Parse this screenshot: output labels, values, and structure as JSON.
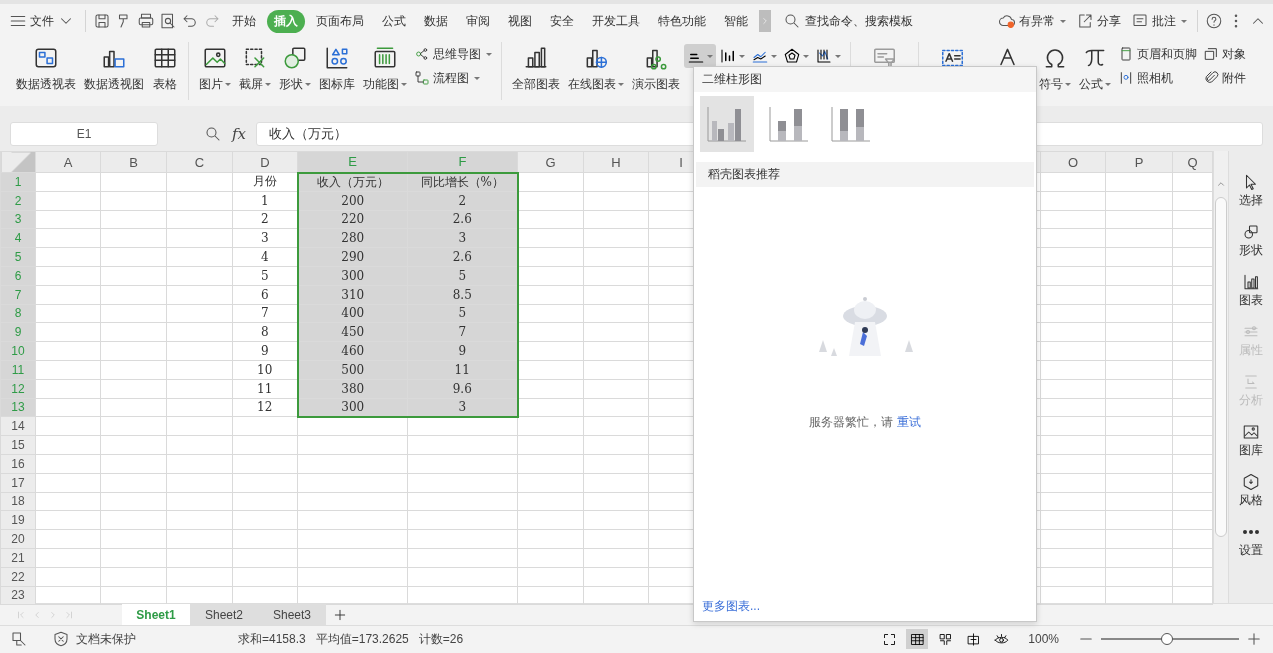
{
  "title_bar": {
    "menu": "文件",
    "tabs": [
      {
        "label": "开始",
        "selected": false
      },
      {
        "label": "插入",
        "selected": true
      },
      {
        "label": "页面布局",
        "selected": false
      },
      {
        "label": "公式",
        "selected": false
      },
      {
        "label": "数据",
        "selected": false
      },
      {
        "label": "审阅",
        "selected": false
      },
      {
        "label": "视图",
        "selected": false
      },
      {
        "label": "安全",
        "selected": false
      },
      {
        "label": "开发工具",
        "selected": false
      },
      {
        "label": "特色功能",
        "selected": false
      },
      {
        "label": "智能",
        "selected": false
      }
    ],
    "search": {
      "placeholder": "查找命令、搜索模板"
    },
    "actions": [
      {
        "label": "有异常",
        "dropdown": true
      },
      {
        "label": "分享",
        "dropdown": false
      },
      {
        "label": "批注",
        "dropdown": true
      }
    ]
  },
  "ribbon": {
    "groups": [
      {
        "items": [
          {
            "kind": "big",
            "label": "数据透视表"
          },
          {
            "kind": "big",
            "label": "数据透视图"
          },
          {
            "kind": "big",
            "label": "表格"
          }
        ]
      },
      {
        "items": [
          {
            "kind": "big",
            "label": "图片",
            "dropdown": true
          },
          {
            "kind": "big",
            "label": "截屏",
            "dropdown": true
          },
          {
            "kind": "big",
            "label": "形状",
            "dropdown": true
          },
          {
            "kind": "big",
            "label": "图标库"
          },
          {
            "kind": "big",
            "label": "功能图",
            "dropdown": true
          },
          {
            "kind": "stack",
            "rows": [
              {
                "label": "思维导图",
                "dropdown": true
              },
              {
                "label": "流程图",
                "dropdown": true
              }
            ]
          }
        ]
      },
      {
        "items": [
          {
            "kind": "big",
            "label": "全部图表"
          },
          {
            "kind": "big",
            "label": "在线图表",
            "dropdown": true
          },
          {
            "kind": "big",
            "label": "演示图表"
          },
          {
            "kind": "mini",
            "selected": true
          },
          {
            "kind": "mini",
            "selected": false
          },
          {
            "kind": "mini",
            "selected": false
          },
          {
            "kind": "mini",
            "selected": false
          },
          {
            "kind": "mini",
            "selected": false
          }
        ]
      },
      {
        "items": [
          {
            "kind": "icon",
            "disabled": true
          }
        ]
      },
      {
        "items": [
          {
            "kind": "icon",
            "disabled": false
          },
          {
            "kind": "icon",
            "disabled": false
          },
          {
            "kind": "big",
            "label": "符号",
            "dropdown": true
          },
          {
            "kind": "big",
            "label": "公式",
            "dropdown": true
          },
          {
            "kind": "stack",
            "rows": [
              {
                "label": "页眉和页脚",
                "dropdown": false
              },
              {
                "label": "照相机",
                "dropdown": false
              }
            ]
          },
          {
            "kind": "stack",
            "rows": [
              {
                "label": "对象",
                "dropdown": false
              },
              {
                "label": "附件",
                "dropdown": false
              }
            ]
          }
        ]
      }
    ]
  },
  "formula_bar": {
    "name_box": "E1",
    "function_label": "fx",
    "value": "收入（万元）"
  },
  "sheet": {
    "columns": [
      {
        "label": "A",
        "selected": false
      },
      {
        "label": "B",
        "selected": false
      },
      {
        "label": "C",
        "selected": false
      },
      {
        "label": "D",
        "selected": false
      },
      {
        "label": "E",
        "selected": true
      },
      {
        "label": "F",
        "selected": true
      },
      {
        "label": "G",
        "selected": false
      },
      {
        "label": "H",
        "selected": false
      },
      {
        "label": "I",
        "selected": false
      },
      {
        "label": "O",
        "selected": false
      },
      {
        "label": "P",
        "selected": false
      },
      {
        "label": "Q",
        "selected": false
      }
    ],
    "rows": [
      {
        "label": "1",
        "selected": true,
        "cells": {
          "D": "月份",
          "E": "收入（万元）",
          "F": "同比增长（%）"
        }
      },
      {
        "label": "2",
        "selected": true,
        "cells": {
          "D": "1",
          "E": "200",
          "F": "2"
        }
      },
      {
        "label": "3",
        "selected": true,
        "cells": {
          "D": "2",
          "E": "220",
          "F": "2.6"
        }
      },
      {
        "label": "4",
        "selected": true,
        "cells": {
          "D": "3",
          "E": "280",
          "F": "3"
        }
      },
      {
        "label": "5",
        "selected": true,
        "cells": {
          "D": "4",
          "E": "290",
          "F": "2.6"
        }
      },
      {
        "label": "6",
        "selected": true,
        "cells": {
          "D": "5",
          "E": "300",
          "F": "5"
        }
      },
      {
        "label": "7",
        "selected": true,
        "cells": {
          "D": "6",
          "E": "310",
          "F": "8.5"
        }
      },
      {
        "label": "8",
        "selected": true,
        "cells": {
          "D": "7",
          "E": "400",
          "F": "5"
        }
      },
      {
        "label": "9",
        "selected": true,
        "cells": {
          "D": "8",
          "E": "450",
          "F": "7"
        }
      },
      {
        "label": "10",
        "selected": true,
        "cells": {
          "D": "9",
          "E": "460",
          "F": "9"
        }
      },
      {
        "label": "11",
        "selected": true,
        "cells": {
          "D": "10",
          "E": "500",
          "F": "11"
        }
      },
      {
        "label": "12",
        "selected": true,
        "cells": {
          "D": "11",
          "E": "380",
          "F": "9.6"
        }
      },
      {
        "label": "13",
        "selected": true,
        "cells": {
          "D": "12",
          "E": "300",
          "F": "3"
        }
      },
      {
        "label": "14",
        "selected": false
      },
      {
        "label": "15",
        "selected": false
      },
      {
        "label": "16",
        "selected": false
      },
      {
        "label": "17",
        "selected": false
      },
      {
        "label": "18",
        "selected": false
      },
      {
        "label": "19",
        "selected": false
      },
      {
        "label": "20",
        "selected": false
      },
      {
        "label": "21",
        "selected": false
      },
      {
        "label": "22",
        "selected": false
      },
      {
        "label": "23",
        "selected": false
      }
    ]
  },
  "sheet_tabs": [
    {
      "label": "Sheet1",
      "selected": true
    },
    {
      "label": "Sheet2",
      "selected": false
    },
    {
      "label": "Sheet3",
      "selected": false
    }
  ],
  "chart_menu": {
    "section": "二维柱形图",
    "chart_types": [
      {
        "kind": "clustered",
        "selected": true
      },
      {
        "kind": "stacked",
        "selected": false
      },
      {
        "kind": "percent",
        "selected": false
      }
    ],
    "recommend": "稻壳图表推荐",
    "message": "服务器繁忙，请",
    "retry": "重试",
    "more": "更多图表..."
  },
  "side_panel": [
    {
      "label": "选择",
      "disabled": false
    },
    {
      "label": "形状",
      "disabled": false
    },
    {
      "label": "图表",
      "disabled": false
    },
    {
      "label": "属性",
      "disabled": true
    },
    {
      "label": "分析",
      "disabled": true
    },
    {
      "label": "图库",
      "disabled": false
    },
    {
      "label": "风格",
      "disabled": false
    },
    {
      "label": "设置",
      "disabled": false
    }
  ],
  "status_bar": {
    "protection": "文档未保护",
    "stats": [
      "求和=4158.3",
      "平均值=173.2625",
      "计数=26"
    ],
    "views": [
      {
        "selected": false
      },
      {
        "selected": true
      },
      {
        "selected": false
      },
      {
        "selected": false
      },
      {
        "selected": false
      }
    ],
    "zoom": "100%",
    "zoom_level": {
      "level": 0.48
    }
  }
}
